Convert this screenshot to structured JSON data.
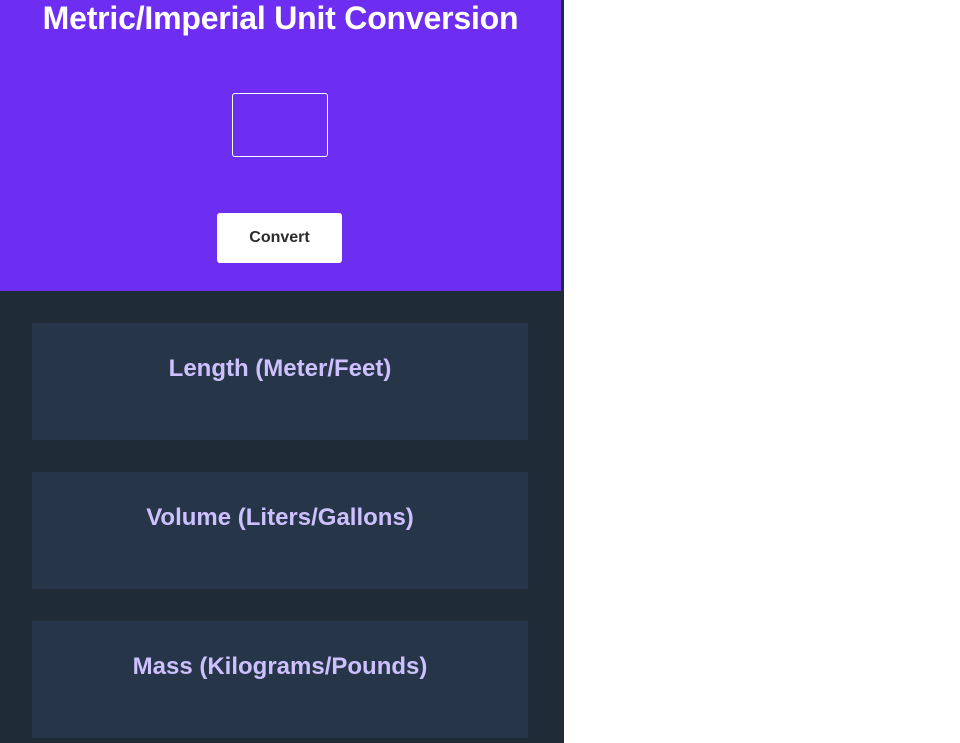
{
  "header": {
    "title": "Metric/Imperial Unit Conversion",
    "input_value": "",
    "convert_label": "Convert"
  },
  "cards": [
    {
      "title": "Length (Meter/Feet)",
      "result": ""
    },
    {
      "title": "Volume (Liters/Gallons)",
      "result": ""
    },
    {
      "title": "Mass (Kilograms/Pounds)",
      "result": ""
    }
  ],
  "colors": {
    "hero_background": "#6d2ef2",
    "page_background": "#1f2b37",
    "card_background": "#273548",
    "card_title": "#cdc0ff",
    "button_background": "#ffffff"
  }
}
